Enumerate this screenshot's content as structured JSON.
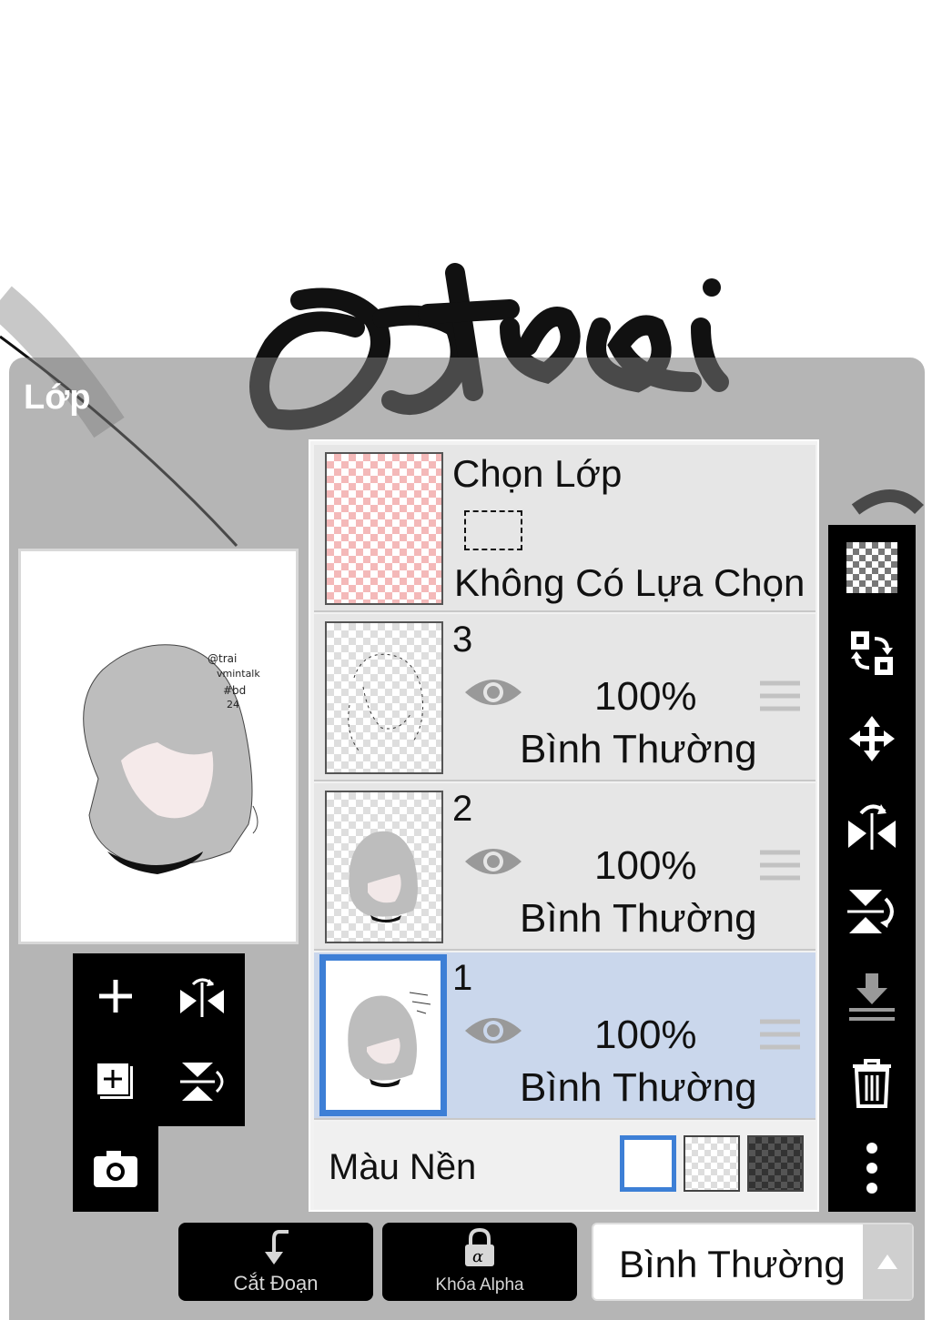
{
  "panel": {
    "title": "Lớp"
  },
  "layers": [
    {
      "kind": "selection",
      "title": "Chọn Lớp",
      "subtitle": "Không Có Lựa Chọn"
    },
    {
      "number": "3",
      "opacity": "100%",
      "blend": "Bình Thường",
      "selected": false
    },
    {
      "number": "2",
      "opacity": "100%",
      "blend": "Bình Thường",
      "selected": false
    },
    {
      "number": "1",
      "opacity": "100%",
      "blend": "Bình Thường",
      "selected": true
    }
  ],
  "background": {
    "label": "Màu Nền",
    "options": [
      "white",
      "transparent",
      "dark-checker"
    ],
    "selected": "white"
  },
  "bottom_bar": {
    "clip_label": "Cắt Đoạn",
    "alpha_lock_label": "Khóa Alpha",
    "blend_mode": "Bình Thường"
  },
  "left_tools": [
    "add-layer",
    "flip-horizontal",
    "add-copy-layer",
    "flip-vertical",
    "camera"
  ],
  "right_tools": [
    "transparency",
    "swap-layers",
    "move",
    "flip-horizontal",
    "flip-vertical",
    "merge-down",
    "delete",
    "more"
  ],
  "colors": {
    "accent": "#3d7fd6",
    "selected_row": "#cad7ec",
    "toolbar": "#000000"
  }
}
